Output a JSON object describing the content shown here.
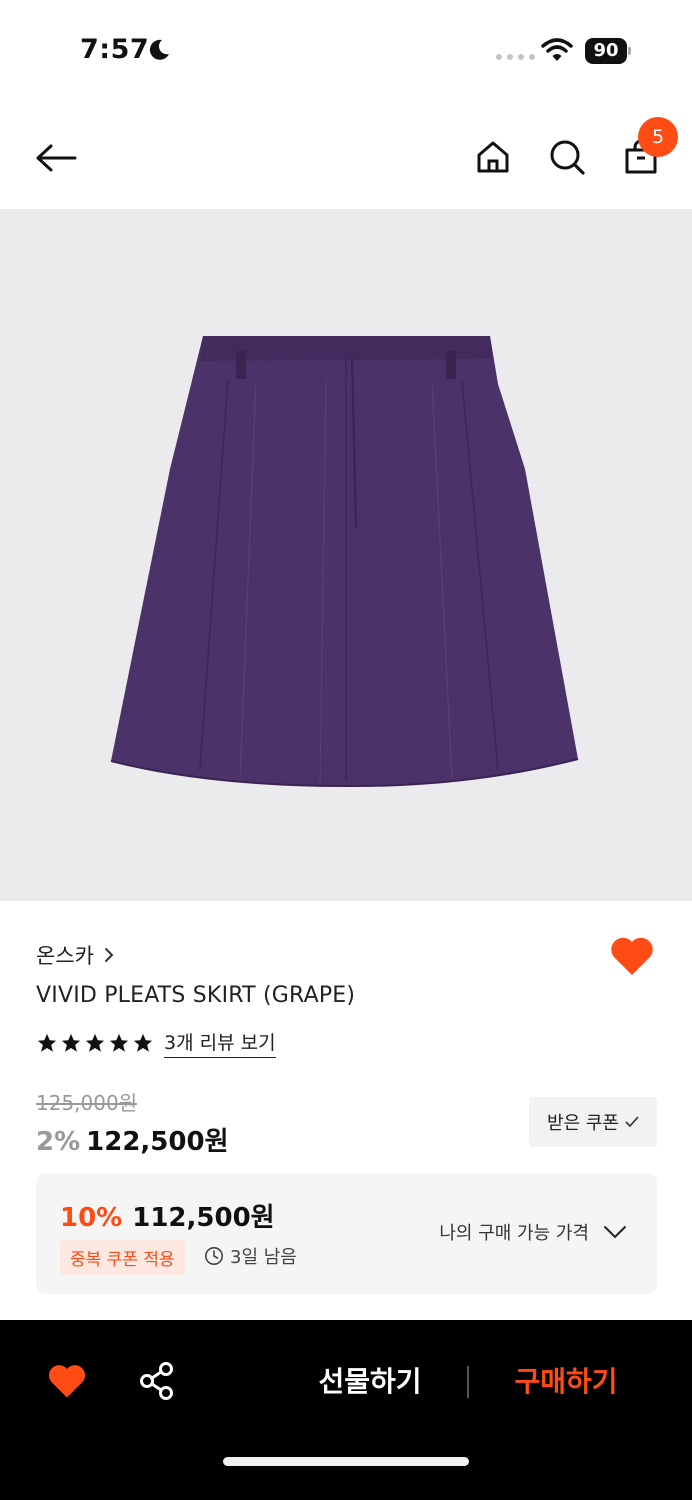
{
  "status_bar": {
    "time": "7:57",
    "battery": "90"
  },
  "header": {
    "cart_count": "5"
  },
  "product": {
    "brand": "온스카",
    "name": "VIVID PLEATS SKIRT (GRAPE)",
    "rating_stars": 5,
    "review_link": "3개 리뷰 보기",
    "original_price": "125,000원",
    "discount_rate": "2%",
    "sale_price": "122,500원",
    "coupon_button": "받은 쿠폰",
    "skirt_color": "#4b3268"
  },
  "my_price": {
    "discount_rate": "10%",
    "price": "112,500원",
    "coupon_tag": "중복 쿠폰 적용",
    "time_left": "3일 남음",
    "link_label": "나의 구매 가능 가격"
  },
  "bottom_bar": {
    "gift_label": "선물하기",
    "buy_label": "구매하기"
  },
  "colors": {
    "accent": "#ff4b14",
    "image_background": "#ebebed"
  }
}
